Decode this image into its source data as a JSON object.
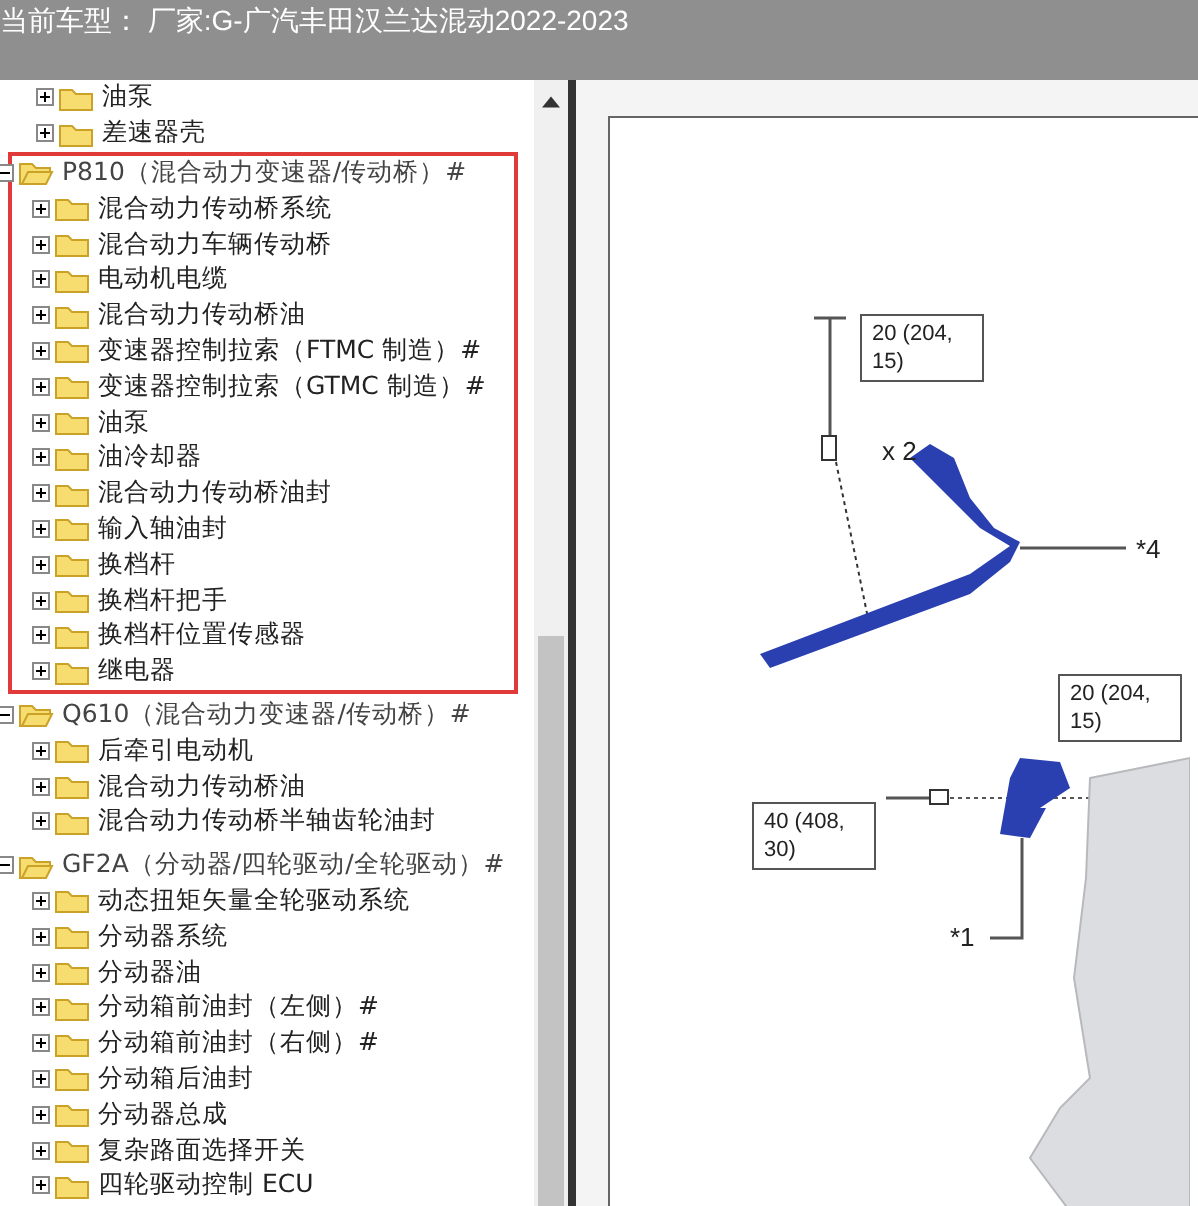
{
  "header": {
    "title": "当前车型： 厂家:G-广汽丰田汉兰达混动2022-2023"
  },
  "tree": {
    "items": [
      {
        "label": "油泵",
        "expanded": false
      },
      {
        "label": "差速器壳",
        "expanded": false
      }
    ],
    "groups": [
      {
        "label": "P810（混合动力变速器/传动桥）#",
        "expanded": true,
        "highlighted": true,
        "children": [
          {
            "label": "混合动力传动桥系统",
            "expanded": false
          },
          {
            "label": "混合动力车辆传动桥",
            "expanded": false
          },
          {
            "label": "电动机电缆",
            "expanded": false
          },
          {
            "label": "混合动力传动桥油",
            "expanded": false
          },
          {
            "label": "变速器控制拉索（FTMC 制造）#",
            "expanded": false
          },
          {
            "label": "变速器控制拉索（GTMC 制造）#",
            "expanded": false
          },
          {
            "label": "油泵",
            "expanded": false
          },
          {
            "label": "油冷却器",
            "expanded": false
          },
          {
            "label": "混合动力传动桥油封",
            "expanded": false
          },
          {
            "label": "输入轴油封",
            "expanded": false
          },
          {
            "label": "换档杆",
            "expanded": false
          },
          {
            "label": "换档杆把手",
            "expanded": false
          },
          {
            "label": "换档杆位置传感器",
            "expanded": false
          },
          {
            "label": "继电器",
            "expanded": false
          }
        ]
      },
      {
        "label": "Q610（混合动力变速器/传动桥）#",
        "expanded": true,
        "highlighted": false,
        "children": [
          {
            "label": "后牵引电动机",
            "expanded": false
          },
          {
            "label": "混合动力传动桥油",
            "expanded": false
          },
          {
            "label": "混合动力传动桥半轴齿轮油封",
            "expanded": false
          }
        ]
      },
      {
        "label": "GF2A（分动器/四轮驱动/全轮驱动）#",
        "expanded": true,
        "highlighted": false,
        "children": [
          {
            "label": "动态扭矩矢量全轮驱动系统",
            "expanded": false
          },
          {
            "label": "分动器系统",
            "expanded": false
          },
          {
            "label": "分动器油",
            "expanded": false
          },
          {
            "label": "分动箱前油封（左侧）#",
            "expanded": false
          },
          {
            "label": "分动箱前油封（右侧）#",
            "expanded": false
          },
          {
            "label": "分动箱后油封",
            "expanded": false
          },
          {
            "label": "分动器总成",
            "expanded": false
          },
          {
            "label": "复杂路面选择开关",
            "expanded": false
          },
          {
            "label": "四轮驱动控制 ECU",
            "expanded": false
          }
        ]
      }
    ]
  },
  "diagram": {
    "callouts": [
      {
        "kind": "torque",
        "text": "20 (204, 15)"
      },
      {
        "kind": "label",
        "text": "x 2"
      },
      {
        "kind": "label",
        "text": "*4"
      },
      {
        "kind": "torque",
        "text": "20 (204, 15)"
      },
      {
        "kind": "torque",
        "text": "40 (408, 30)"
      },
      {
        "kind": "label",
        "text": "*1"
      }
    ]
  }
}
